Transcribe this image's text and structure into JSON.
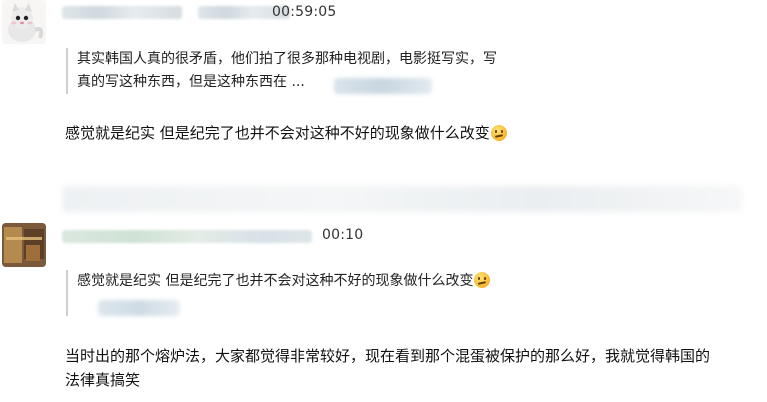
{
  "messages": [
    {
      "timestamp": "00:59:05",
      "quote": {
        "line1": "其实韩国人真的很矛盾，他们拍了很多那种电视剧，电影挺写实，写",
        "line2": "真的写这种东西，但是这种东西在 ..."
      },
      "text": "感觉就是纪实 但是纪完了也并不会对这种不好的现象做什么改变",
      "emoji": "confused-face-emoji"
    },
    {
      "timestamp": "00:10",
      "quote": {
        "line1": "感觉就是纪实 但是纪完了也并不会对这种不好的现象做什么改变"
      },
      "quote_emoji": "confused-face-emoji",
      "text_line1": "当时出的那个熔炉法，大家都觉得非常较好，现在看到那个混蛋被保护的那么好，我就觉得韩国的",
      "text_line2": "法律真搞笑"
    }
  ],
  "colors": {
    "quote_border": "#cfcfcf",
    "text": "#111111",
    "timestamp": "#333333"
  }
}
